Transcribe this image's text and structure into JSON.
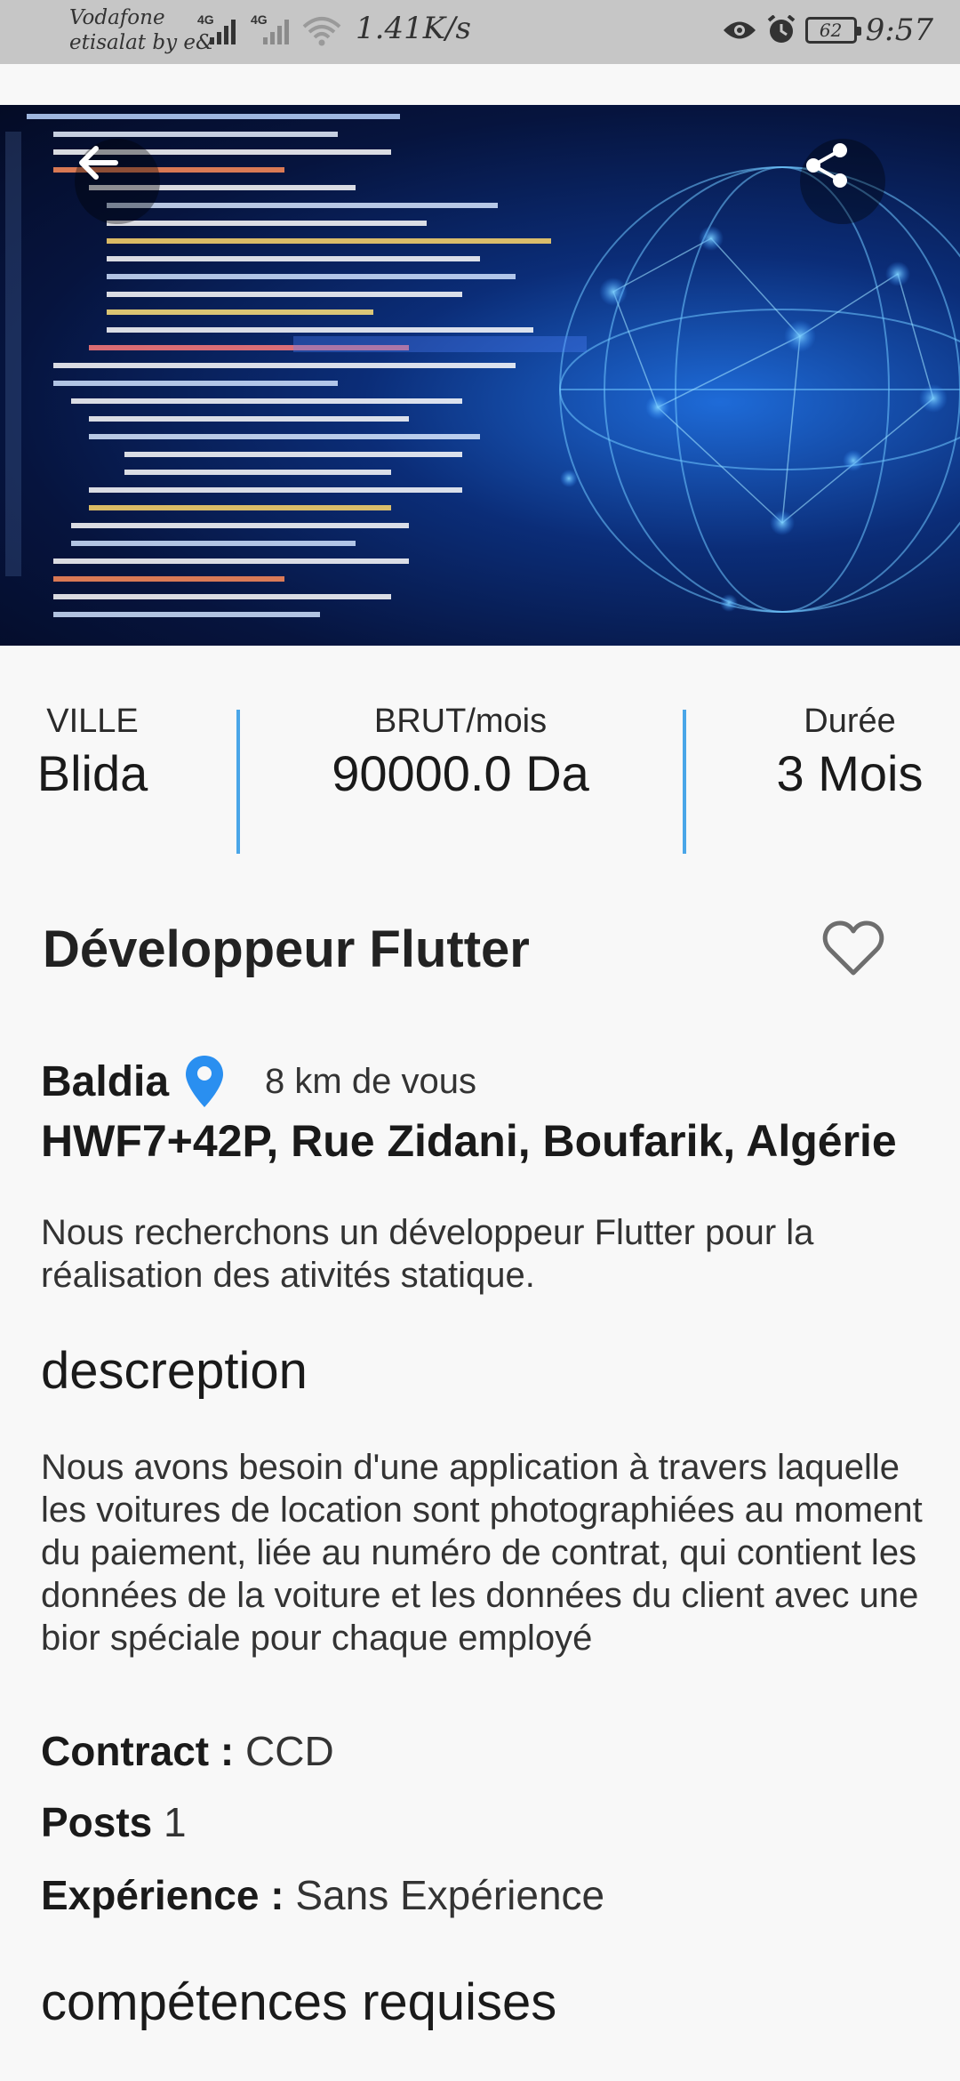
{
  "status_bar": {
    "carrier_line1": "Vodafone",
    "carrier_line2": "etisalat by e&",
    "net1": "4G",
    "net2": "4G",
    "speed": "1.41K/s",
    "battery": "62",
    "time": "9:57"
  },
  "hero": {
    "back_icon": "arrow-back-icon",
    "share_icon": "share-icon"
  },
  "stats": {
    "city_label": "VILLE",
    "city_value": "Blida",
    "salary_label": "BRUT/mois",
    "salary_value": "90000.0 Da",
    "duration_label": "Durée",
    "duration_value": "3 Mois",
    "divider_color": "#4aa6e8"
  },
  "job": {
    "title": "Développeur Flutter",
    "favorite_icon": "heart-outline-icon",
    "location_name": "Baldia",
    "distance": "8 km de vous",
    "address": "HWF7+42P, Rue Zidani, Boufarik, Algérie",
    "summary": "Nous recherchons un développeur Flutter pour la réalisation des ativités statique.",
    "description_heading": "descreption",
    "description": "Nous avons besoin d'une application à travers laquelle les voitures de location sont photographiées au moment du paiement, liée au numéro de contrat, qui contient les données de la voiture et les données du client avec une bior spéciale pour chaque employé",
    "contract_label": "Contract :",
    "contract_value": "CCD",
    "posts_label": "Posts",
    "posts_value": "1",
    "experience_label": "Expérience :",
    "experience_value": "Sans Expérience",
    "skills_heading": "compétences requises"
  },
  "colors": {
    "accent": "#4aa6e8",
    "pin": "#2a8ff0"
  }
}
